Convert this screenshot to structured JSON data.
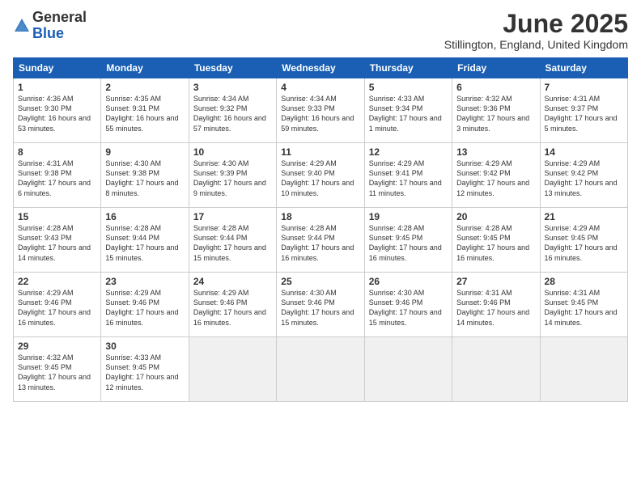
{
  "logo": {
    "general": "General",
    "blue": "Blue"
  },
  "title": "June 2025",
  "subtitle": "Stillington, England, United Kingdom",
  "headers": [
    "Sunday",
    "Monday",
    "Tuesday",
    "Wednesday",
    "Thursday",
    "Friday",
    "Saturday"
  ],
  "weeks": [
    [
      {
        "day": "1",
        "sunrise": "4:36 AM",
        "sunset": "9:30 PM",
        "daylight": "16 hours and 53 minutes."
      },
      {
        "day": "2",
        "sunrise": "4:35 AM",
        "sunset": "9:31 PM",
        "daylight": "16 hours and 55 minutes."
      },
      {
        "day": "3",
        "sunrise": "4:34 AM",
        "sunset": "9:32 PM",
        "daylight": "16 hours and 57 minutes."
      },
      {
        "day": "4",
        "sunrise": "4:34 AM",
        "sunset": "9:33 PM",
        "daylight": "16 hours and 59 minutes."
      },
      {
        "day": "5",
        "sunrise": "4:33 AM",
        "sunset": "9:34 PM",
        "daylight": "17 hours and 1 minute."
      },
      {
        "day": "6",
        "sunrise": "4:32 AM",
        "sunset": "9:36 PM",
        "daylight": "17 hours and 3 minutes."
      },
      {
        "day": "7",
        "sunrise": "4:31 AM",
        "sunset": "9:37 PM",
        "daylight": "17 hours and 5 minutes."
      }
    ],
    [
      {
        "day": "8",
        "sunrise": "4:31 AM",
        "sunset": "9:38 PM",
        "daylight": "17 hours and 6 minutes."
      },
      {
        "day": "9",
        "sunrise": "4:30 AM",
        "sunset": "9:38 PM",
        "daylight": "17 hours and 8 minutes."
      },
      {
        "day": "10",
        "sunrise": "4:30 AM",
        "sunset": "9:39 PM",
        "daylight": "17 hours and 9 minutes."
      },
      {
        "day": "11",
        "sunrise": "4:29 AM",
        "sunset": "9:40 PM",
        "daylight": "17 hours and 10 minutes."
      },
      {
        "day": "12",
        "sunrise": "4:29 AM",
        "sunset": "9:41 PM",
        "daylight": "17 hours and 11 minutes."
      },
      {
        "day": "13",
        "sunrise": "4:29 AM",
        "sunset": "9:42 PM",
        "daylight": "17 hours and 12 minutes."
      },
      {
        "day": "14",
        "sunrise": "4:29 AM",
        "sunset": "9:42 PM",
        "daylight": "17 hours and 13 minutes."
      }
    ],
    [
      {
        "day": "15",
        "sunrise": "4:28 AM",
        "sunset": "9:43 PM",
        "daylight": "17 hours and 14 minutes."
      },
      {
        "day": "16",
        "sunrise": "4:28 AM",
        "sunset": "9:44 PM",
        "daylight": "17 hours and 15 minutes."
      },
      {
        "day": "17",
        "sunrise": "4:28 AM",
        "sunset": "9:44 PM",
        "daylight": "17 hours and 15 minutes."
      },
      {
        "day": "18",
        "sunrise": "4:28 AM",
        "sunset": "9:44 PM",
        "daylight": "17 hours and 16 minutes."
      },
      {
        "day": "19",
        "sunrise": "4:28 AM",
        "sunset": "9:45 PM",
        "daylight": "17 hours and 16 minutes."
      },
      {
        "day": "20",
        "sunrise": "4:28 AM",
        "sunset": "9:45 PM",
        "daylight": "17 hours and 16 minutes."
      },
      {
        "day": "21",
        "sunrise": "4:29 AM",
        "sunset": "9:45 PM",
        "daylight": "17 hours and 16 minutes."
      }
    ],
    [
      {
        "day": "22",
        "sunrise": "4:29 AM",
        "sunset": "9:46 PM",
        "daylight": "17 hours and 16 minutes."
      },
      {
        "day": "23",
        "sunrise": "4:29 AM",
        "sunset": "9:46 PM",
        "daylight": "17 hours and 16 minutes."
      },
      {
        "day": "24",
        "sunrise": "4:29 AM",
        "sunset": "9:46 PM",
        "daylight": "17 hours and 16 minutes."
      },
      {
        "day": "25",
        "sunrise": "4:30 AM",
        "sunset": "9:46 PM",
        "daylight": "17 hours and 15 minutes."
      },
      {
        "day": "26",
        "sunrise": "4:30 AM",
        "sunset": "9:46 PM",
        "daylight": "17 hours and 15 minutes."
      },
      {
        "day": "27",
        "sunrise": "4:31 AM",
        "sunset": "9:46 PM",
        "daylight": "17 hours and 14 minutes."
      },
      {
        "day": "28",
        "sunrise": "4:31 AM",
        "sunset": "9:45 PM",
        "daylight": "17 hours and 14 minutes."
      }
    ],
    [
      {
        "day": "29",
        "sunrise": "4:32 AM",
        "sunset": "9:45 PM",
        "daylight": "17 hours and 13 minutes."
      },
      {
        "day": "30",
        "sunrise": "4:33 AM",
        "sunset": "9:45 PM",
        "daylight": "17 hours and 12 minutes."
      },
      null,
      null,
      null,
      null,
      null
    ]
  ]
}
